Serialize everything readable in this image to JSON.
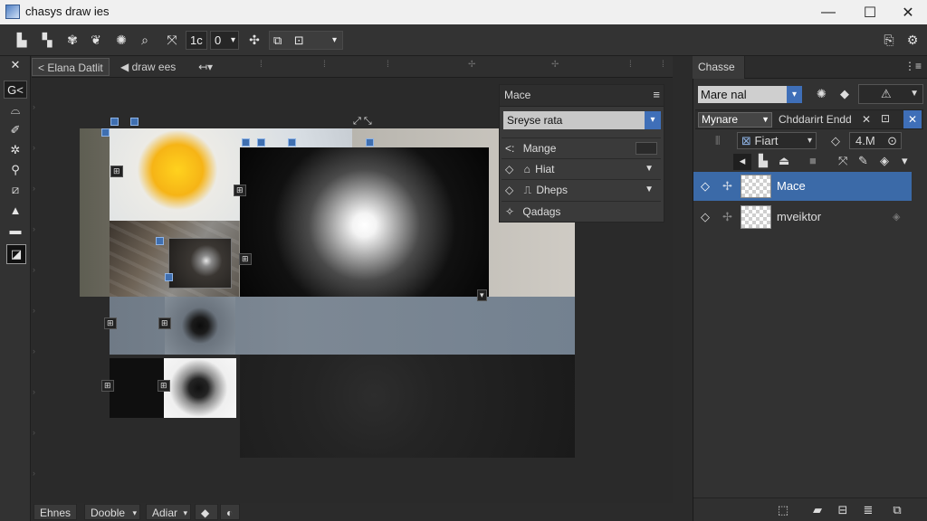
{
  "window": {
    "title": "chasys draw ies",
    "minimize": "—",
    "maximize": "☐",
    "close": "✕"
  },
  "toolbar": {
    "items": [
      {
        "icon": "new-file-icon",
        "glyph": "▙"
      },
      {
        "icon": "paste-icon",
        "glyph": "▚"
      },
      {
        "icon": "stamp-icon",
        "glyph": "✾"
      },
      {
        "icon": "brush-icon",
        "glyph": "❦"
      },
      {
        "icon": "gear-icon",
        "glyph": "✺"
      },
      {
        "icon": "zoom-icon",
        "glyph": "⌕"
      },
      {
        "icon": "crop-icon",
        "glyph": "⤧"
      }
    ],
    "field1": "1c",
    "field2": "0",
    "field2_arrow": "▾",
    "item_after": {
      "icon": "arrows-icon",
      "glyph": "✣"
    },
    "item_after2": {
      "icon": "copy-icon",
      "glyph": "⧉"
    },
    "item_after3": {
      "icon": "frame-icon",
      "glyph": "⊡"
    },
    "dropdown_arrow": "▾",
    "right_icon1": {
      "icon": "clipboard-icon",
      "glyph": "⎘"
    },
    "right_icon2": {
      "icon": "settings-icon",
      "glyph": "⚙"
    }
  },
  "tools": {
    "close": "✕",
    "items": [
      {
        "icon": "select-tool-icon",
        "glyph": "G<"
      },
      {
        "icon": "lasso-tool-icon",
        "glyph": "⌓"
      },
      {
        "icon": "pen-tool-icon",
        "glyph": "✐"
      },
      {
        "icon": "clone-tool-icon",
        "glyph": "✲"
      },
      {
        "icon": "lightbulb-tool-icon",
        "glyph": "⚲"
      },
      {
        "icon": "eraser-tool-icon",
        "glyph": "⧄"
      },
      {
        "icon": "bucket-tool-icon",
        "glyph": "▲"
      },
      {
        "icon": "weight-tool-icon",
        "glyph": "▬"
      },
      {
        "icon": "color-swatch-icon",
        "glyph": "◪"
      }
    ]
  },
  "doc": {
    "tab1": "< Elana Datlit",
    "tab2_prefix": "◀",
    "tab2": "draw ees",
    "tab3": "↤▾"
  },
  "panel_mace": {
    "title": "Mace",
    "menu": "≡",
    "dropdown": "Sreyse rata",
    "dropdown_arrow": "▾",
    "rows": [
      {
        "icon": "lt-icon",
        "glyph": "<:",
        "label": "Mange"
      },
      {
        "icon": "diamond-icon",
        "glyph": "◇",
        "label": "Hiat",
        "icon2": "⌂"
      },
      {
        "icon": "diamond-icon",
        "glyph": "◇",
        "label": "Dheps",
        "icon2": "⎍"
      },
      {
        "icon": "gear-icon",
        "glyph": "✧",
        "label": "Qadags"
      }
    ]
  },
  "rightpanel": {
    "tab": "Chasse",
    "tab_icon": "⋮≡",
    "blend_select": "Mare nal",
    "blend_arrow": "▾",
    "icons_row1": [
      "✺",
      "◆",
      "⚠"
    ],
    "row2_label1": "Mynare",
    "row2_label2": "Chddarirt Endd",
    "row2_close": "✕",
    "row3_label": "Fiart",
    "row3_value": "4.M",
    "row3_arrow": "▾",
    "layers": [
      {
        "name": "Mace",
        "selected": true
      },
      {
        "name": "mveiktor",
        "selected": false
      }
    ],
    "bottom_icons": [
      "⬚",
      "▰",
      "⊟",
      "≣",
      "⧉"
    ]
  },
  "bottom": {
    "btn1": "Ehnes",
    "btn2": "Dooble",
    "btn2_arrow": "▾",
    "btn3": "Adiar",
    "btn3_arrow": "▾",
    "btn4": "◆",
    "btn5": "◐"
  }
}
